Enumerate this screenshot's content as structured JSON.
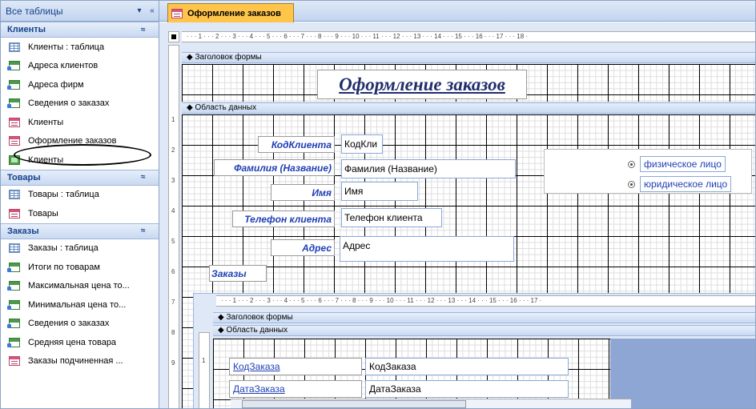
{
  "nav": {
    "header": "Все таблицы",
    "header_btn1": "▾",
    "header_btn2": "«",
    "groups": [
      {
        "title": "Клиенты",
        "collapse": "≈",
        "items": [
          {
            "label": "Клиенты : таблица",
            "icon": "table-icon"
          },
          {
            "label": "Адреса клиентов",
            "icon": "query-icon"
          },
          {
            "label": "Адреса фирм",
            "icon": "query-icon"
          },
          {
            "label": "Сведения о заказах",
            "icon": "query-icon"
          },
          {
            "label": "Клиенты",
            "icon": "form-icon"
          },
          {
            "label": "Оформление заказов",
            "icon": "form-icon"
          },
          {
            "label": "Клиенты",
            "icon": "report-icon"
          }
        ]
      },
      {
        "title": "Товары",
        "collapse": "≈",
        "items": [
          {
            "label": "Товары : таблица",
            "icon": "table-icon"
          },
          {
            "label": "Товары",
            "icon": "form-icon"
          }
        ]
      },
      {
        "title": "Заказы",
        "collapse": "≈",
        "items": [
          {
            "label": "Заказы : таблица",
            "icon": "table-icon"
          },
          {
            "label": "Итоги по товарам",
            "icon": "query-icon"
          },
          {
            "label": "Максимальная цена то...",
            "icon": "query-icon"
          },
          {
            "label": "Минимальная цена то...",
            "icon": "query-icon"
          },
          {
            "label": "Сведения о заказах",
            "icon": "query-icon"
          },
          {
            "label": "Средняя цена товара",
            "icon": "query-icon"
          },
          {
            "label": "Заказы подчиненная ...",
            "icon": "form-icon"
          }
        ]
      }
    ]
  },
  "tab": {
    "label": "Оформление заказов"
  },
  "ruler": {
    "marks": "· · · 1 · · · 2 · · · 3 · · · 4 · · · 5 · · · 6 · · · 7 · · · 8 · · · 9 · · · 10 · · · 11 · · · 12 · · · 13 · · · 14 · · · 15 · · · 16 · · · 17 · · · 18 ·",
    "v_marks": [
      "1",
      "2",
      "3",
      "4",
      "5",
      "6",
      "7",
      "8",
      "9"
    ]
  },
  "form": {
    "header_section": "Заголовок формы",
    "detail_section": "Область данных",
    "title": "Оформление заказов",
    "labels": {
      "code": "КодКлиента",
      "name": "Фамилия (Название)",
      "first": "Имя",
      "phone": "Телефон клиента",
      "address": "Адрес",
      "orders": "Заказы"
    },
    "fields": {
      "code": "КодКли",
      "name": "Фамилия (Название)",
      "first": "Имя",
      "phone": "Телефон клиента",
      "address": "Адрес"
    },
    "options": [
      "физическое лицо",
      "юридическое лицо"
    ]
  },
  "subform": {
    "header_section": "Заголовок формы",
    "detail_section": "Область данных",
    "ruler": "· · · 1 · · · 2 · · · 3 · · · 4 · · · 5 · · · 6 · · · 7 · · · 8 · · · 9 · · · 10 · · · 11 · · · 12 · · · 13 · · · 14 · · · 15 · · · 16 · · · 17 ·",
    "v_marks": [
      "1"
    ],
    "labels": [
      "КодЗаказа",
      "ДатаЗаказа"
    ],
    "fields": [
      "КодЗаказа",
      "ДатаЗаказа"
    ]
  }
}
